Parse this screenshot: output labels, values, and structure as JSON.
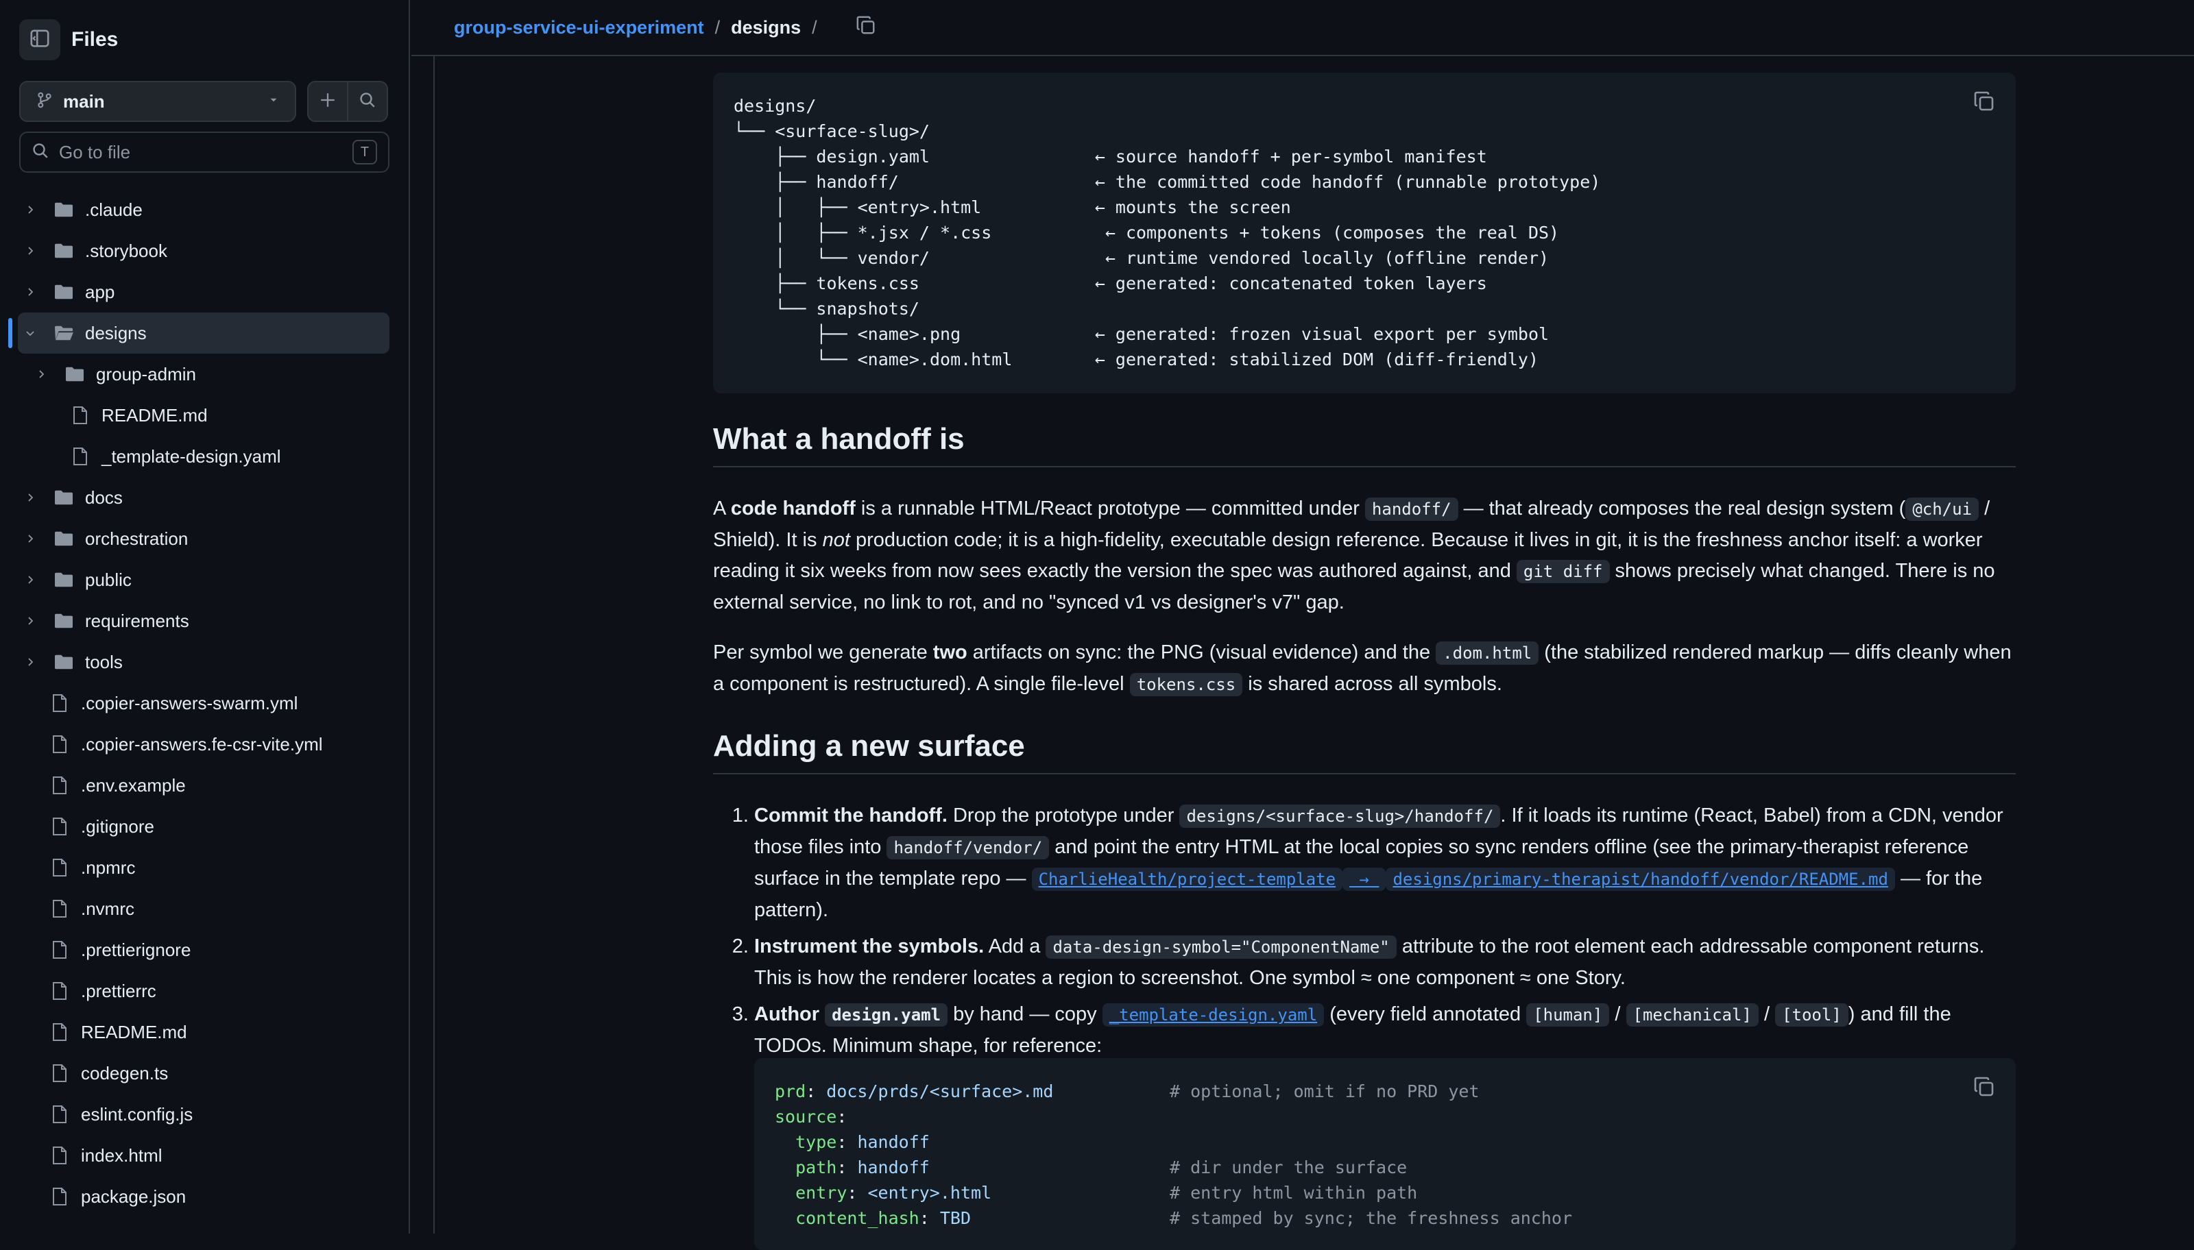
{
  "sidebar": {
    "title": "Files",
    "branch": "main",
    "goto_placeholder": "Go to file",
    "goto_shortcut": "T",
    "tree": [
      {
        "label": ".claude",
        "type": "folder",
        "expanded": false,
        "depth": 0
      },
      {
        "label": ".storybook",
        "type": "folder",
        "expanded": false,
        "depth": 0
      },
      {
        "label": "app",
        "type": "folder",
        "expanded": false,
        "depth": 0
      },
      {
        "label": "designs",
        "type": "folder",
        "expanded": true,
        "depth": 0,
        "selected": true
      },
      {
        "label": "group-admin",
        "type": "folder",
        "expanded": false,
        "depth": 1
      },
      {
        "label": "README.md",
        "type": "file",
        "depth": 1
      },
      {
        "label": "_template-design.yaml",
        "type": "file",
        "depth": 1
      },
      {
        "label": "docs",
        "type": "folder",
        "expanded": false,
        "depth": 0
      },
      {
        "label": "orchestration",
        "type": "folder",
        "expanded": false,
        "depth": 0
      },
      {
        "label": "public",
        "type": "folder",
        "expanded": false,
        "depth": 0
      },
      {
        "label": "requirements",
        "type": "folder",
        "expanded": false,
        "depth": 0
      },
      {
        "label": "tools",
        "type": "folder",
        "expanded": false,
        "depth": 0
      },
      {
        "label": ".copier-answers-swarm.yml",
        "type": "file",
        "depth": 0
      },
      {
        "label": ".copier-answers.fe-csr-vite.yml",
        "type": "file",
        "depth": 0
      },
      {
        "label": ".env.example",
        "type": "file",
        "depth": 0
      },
      {
        "label": ".gitignore",
        "type": "file",
        "depth": 0
      },
      {
        "label": ".npmrc",
        "type": "file",
        "depth": 0
      },
      {
        "label": ".nvmrc",
        "type": "file",
        "depth": 0
      },
      {
        "label": ".prettierignore",
        "type": "file",
        "depth": 0
      },
      {
        "label": ".prettierrc",
        "type": "file",
        "depth": 0
      },
      {
        "label": "README.md",
        "type": "file",
        "depth": 0
      },
      {
        "label": "codegen.ts",
        "type": "file",
        "depth": 0
      },
      {
        "label": "eslint.config.js",
        "type": "file",
        "depth": 0
      },
      {
        "label": "index.html",
        "type": "file",
        "depth": 0
      },
      {
        "label": "package.json",
        "type": "file",
        "depth": 0
      }
    ]
  },
  "breadcrumb": {
    "repo": "group-service-ui-experiment",
    "sep": "/",
    "current": "designs",
    "trailing_sep": "/"
  },
  "tree_block": "designs/\n└── <surface-slug>/\n    ├── design.yaml                ← source handoff + per-symbol manifest\n    ├── handoff/                   ← the committed code handoff (runnable prototype)\n    │   ├── <entry>.html           ← mounts the screen\n    │   ├── *.jsx / *.css           ← components + tokens (composes the real DS)\n    │   └── vendor/                 ← runtime vendored locally (offline render)\n    ├── tokens.css                 ← generated: concatenated token layers\n    └── snapshots/\n        ├── <name>.png             ← generated: frozen visual export per symbol\n        └── <name>.dom.html        ← generated: stabilized DOM (diff-friendly)",
  "section1": {
    "heading": "What a handoff is",
    "p1": {
      "t1": "A ",
      "b1": "code handoff",
      "t2": " is a runnable HTML/React prototype — committed under ",
      "c1": "handoff/",
      "t3": " — that already composes the real design system (",
      "c2": "@ch/ui",
      "t4": " / Shield). It is ",
      "i1": "not",
      "t5": " production code; it is a high-fidelity, executable design reference. Because it lives in git, it is the freshness anchor itself: a worker reading it six weeks from now sees exactly the version the spec was authored against, and ",
      "c3": "git diff",
      "t6": " shows precisely what changed. There is no external service, no link to rot, and no \"synced v1 vs designer's v7\" gap."
    },
    "p2": {
      "t1": "Per symbol we generate ",
      "b1": "two",
      "t2": " artifacts on sync: the PNG (visual evidence) and the ",
      "c1": ".dom.html",
      "t3": " (the stabilized rendered markup — diffs cleanly when a component is restructured). A single file-level ",
      "c2": "tokens.css",
      "t4": " is shared across all symbols."
    }
  },
  "section2": {
    "heading": "Adding a new surface",
    "step1": {
      "b": "Commit the handoff.",
      "t1": " Drop the prototype under ",
      "c1": "designs/<surface-slug>/handoff/",
      "t2": ". If it loads its runtime (React, Babel) from a CDN, vendor those files into ",
      "c2": "handoff/vendor/",
      "t3": " and point the entry HTML at the local copies so sync renders offline (see the primary-therapist reference surface in the template repo — ",
      "l1": "CharlieHealth/project-template",
      "l2": " → ",
      "l3": "designs/primary-therapist/handoff/vendor/README.md",
      "t4": " — for the pattern)."
    },
    "step2": {
      "b": "Instrument the symbols.",
      "t1": " Add a ",
      "c1": "data-design-symbol=\"ComponentName\"",
      "t2": " attribute to the root element each addressable component returns. This is how the renderer locates a region to screenshot. One symbol ≈ one component ≈ one Story."
    },
    "step3": {
      "b1": "Author ",
      "c0": "design.yaml",
      "t1": " by hand — copy ",
      "l1": "_template-design.yaml",
      "t2": " (every field annotated ",
      "c1": "[human]",
      "s1": " / ",
      "c2": "[mechanical]",
      "s2": " / ",
      "c3": "[tool]",
      "t3": ") and fill the TODOs. Minimum shape, for reference:"
    }
  },
  "yaml_lines": [
    {
      "key": "prd",
      "val": "docs/prds/<surface>.md",
      "comment": "# optional; omit if no PRD yet",
      "indent": ""
    },
    {
      "key": "source",
      "val": "",
      "comment": "",
      "indent": ""
    },
    {
      "key": "type",
      "val": "handoff",
      "comment": "",
      "indent": "  "
    },
    {
      "key": "path",
      "val": "handoff",
      "comment": "# dir under the surface",
      "indent": "  "
    },
    {
      "key": "entry",
      "val": "<entry>.html",
      "comment": "# entry html within path",
      "indent": "  "
    },
    {
      "key": "content_hash",
      "val": "TBD",
      "comment": "# stamped by sync; the freshness anchor",
      "indent": "  "
    }
  ],
  "colors": {
    "bg": "#0d1117",
    "accent": "#4493f8",
    "border": "#30363d",
    "code_bg": "#151b23"
  }
}
